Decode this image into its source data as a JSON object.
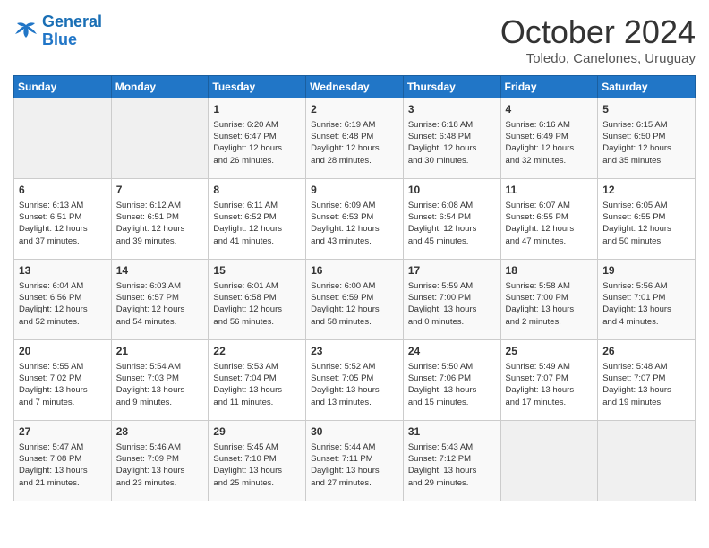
{
  "header": {
    "logo_line1": "General",
    "logo_line2": "Blue",
    "month": "October 2024",
    "location": "Toledo, Canelones, Uruguay"
  },
  "weekdays": [
    "Sunday",
    "Monday",
    "Tuesday",
    "Wednesday",
    "Thursday",
    "Friday",
    "Saturday"
  ],
  "weeks": [
    [
      {
        "day": "",
        "info": ""
      },
      {
        "day": "",
        "info": ""
      },
      {
        "day": "1",
        "info": "Sunrise: 6:20 AM\nSunset: 6:47 PM\nDaylight: 12 hours\nand 26 minutes."
      },
      {
        "day": "2",
        "info": "Sunrise: 6:19 AM\nSunset: 6:48 PM\nDaylight: 12 hours\nand 28 minutes."
      },
      {
        "day": "3",
        "info": "Sunrise: 6:18 AM\nSunset: 6:48 PM\nDaylight: 12 hours\nand 30 minutes."
      },
      {
        "day": "4",
        "info": "Sunrise: 6:16 AM\nSunset: 6:49 PM\nDaylight: 12 hours\nand 32 minutes."
      },
      {
        "day": "5",
        "info": "Sunrise: 6:15 AM\nSunset: 6:50 PM\nDaylight: 12 hours\nand 35 minutes."
      }
    ],
    [
      {
        "day": "6",
        "info": "Sunrise: 6:13 AM\nSunset: 6:51 PM\nDaylight: 12 hours\nand 37 minutes."
      },
      {
        "day": "7",
        "info": "Sunrise: 6:12 AM\nSunset: 6:51 PM\nDaylight: 12 hours\nand 39 minutes."
      },
      {
        "day": "8",
        "info": "Sunrise: 6:11 AM\nSunset: 6:52 PM\nDaylight: 12 hours\nand 41 minutes."
      },
      {
        "day": "9",
        "info": "Sunrise: 6:09 AM\nSunset: 6:53 PM\nDaylight: 12 hours\nand 43 minutes."
      },
      {
        "day": "10",
        "info": "Sunrise: 6:08 AM\nSunset: 6:54 PM\nDaylight: 12 hours\nand 45 minutes."
      },
      {
        "day": "11",
        "info": "Sunrise: 6:07 AM\nSunset: 6:55 PM\nDaylight: 12 hours\nand 47 minutes."
      },
      {
        "day": "12",
        "info": "Sunrise: 6:05 AM\nSunset: 6:55 PM\nDaylight: 12 hours\nand 50 minutes."
      }
    ],
    [
      {
        "day": "13",
        "info": "Sunrise: 6:04 AM\nSunset: 6:56 PM\nDaylight: 12 hours\nand 52 minutes."
      },
      {
        "day": "14",
        "info": "Sunrise: 6:03 AM\nSunset: 6:57 PM\nDaylight: 12 hours\nand 54 minutes."
      },
      {
        "day": "15",
        "info": "Sunrise: 6:01 AM\nSunset: 6:58 PM\nDaylight: 12 hours\nand 56 minutes."
      },
      {
        "day": "16",
        "info": "Sunrise: 6:00 AM\nSunset: 6:59 PM\nDaylight: 12 hours\nand 58 minutes."
      },
      {
        "day": "17",
        "info": "Sunrise: 5:59 AM\nSunset: 7:00 PM\nDaylight: 13 hours\nand 0 minutes."
      },
      {
        "day": "18",
        "info": "Sunrise: 5:58 AM\nSunset: 7:00 PM\nDaylight: 13 hours\nand 2 minutes."
      },
      {
        "day": "19",
        "info": "Sunrise: 5:56 AM\nSunset: 7:01 PM\nDaylight: 13 hours\nand 4 minutes."
      }
    ],
    [
      {
        "day": "20",
        "info": "Sunrise: 5:55 AM\nSunset: 7:02 PM\nDaylight: 13 hours\nand 7 minutes."
      },
      {
        "day": "21",
        "info": "Sunrise: 5:54 AM\nSunset: 7:03 PM\nDaylight: 13 hours\nand 9 minutes."
      },
      {
        "day": "22",
        "info": "Sunrise: 5:53 AM\nSunset: 7:04 PM\nDaylight: 13 hours\nand 11 minutes."
      },
      {
        "day": "23",
        "info": "Sunrise: 5:52 AM\nSunset: 7:05 PM\nDaylight: 13 hours\nand 13 minutes."
      },
      {
        "day": "24",
        "info": "Sunrise: 5:50 AM\nSunset: 7:06 PM\nDaylight: 13 hours\nand 15 minutes."
      },
      {
        "day": "25",
        "info": "Sunrise: 5:49 AM\nSunset: 7:07 PM\nDaylight: 13 hours\nand 17 minutes."
      },
      {
        "day": "26",
        "info": "Sunrise: 5:48 AM\nSunset: 7:07 PM\nDaylight: 13 hours\nand 19 minutes."
      }
    ],
    [
      {
        "day": "27",
        "info": "Sunrise: 5:47 AM\nSunset: 7:08 PM\nDaylight: 13 hours\nand 21 minutes."
      },
      {
        "day": "28",
        "info": "Sunrise: 5:46 AM\nSunset: 7:09 PM\nDaylight: 13 hours\nand 23 minutes."
      },
      {
        "day": "29",
        "info": "Sunrise: 5:45 AM\nSunset: 7:10 PM\nDaylight: 13 hours\nand 25 minutes."
      },
      {
        "day": "30",
        "info": "Sunrise: 5:44 AM\nSunset: 7:11 PM\nDaylight: 13 hours\nand 27 minutes."
      },
      {
        "day": "31",
        "info": "Sunrise: 5:43 AM\nSunset: 7:12 PM\nDaylight: 13 hours\nand 29 minutes."
      },
      {
        "day": "",
        "info": ""
      },
      {
        "day": "",
        "info": ""
      }
    ]
  ]
}
